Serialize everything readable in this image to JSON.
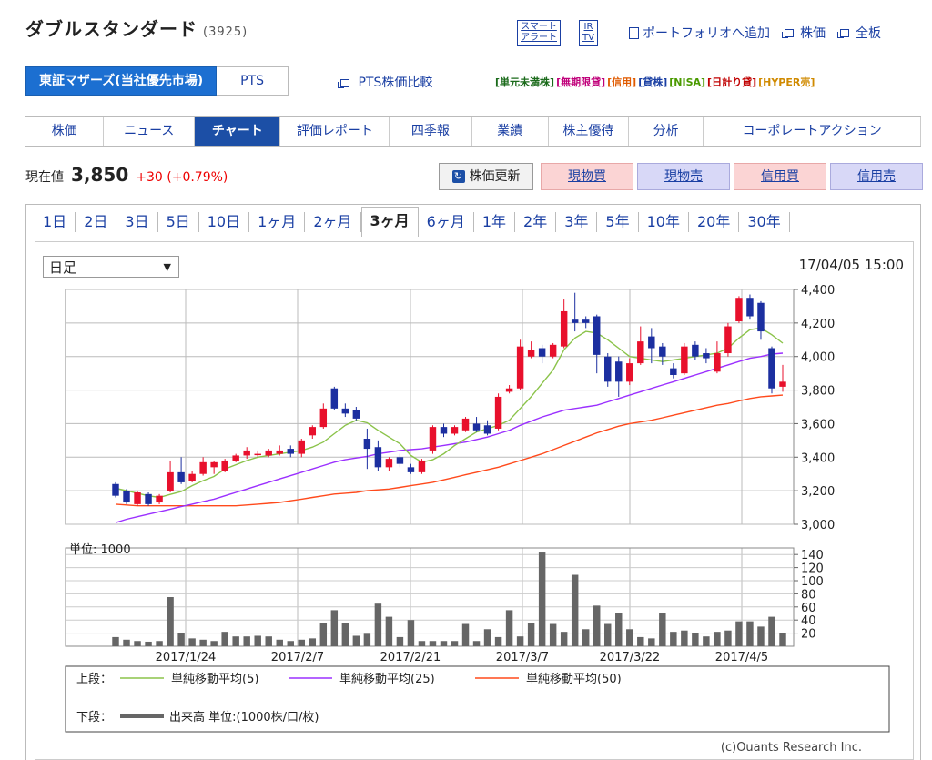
{
  "stock": {
    "name": "ダブルスタンダード",
    "code": "(3925)"
  },
  "top_links": {
    "smart_alert": [
      "スマート",
      "アラート"
    ],
    "ir_tv": [
      "IR",
      "TV"
    ],
    "portfolio": "ポートフォリオへ追加",
    "kabuka": "株価",
    "zenban": "全板"
  },
  "market_tabs": {
    "active": "東証マザーズ(当社優先市場)",
    "other": "PTS"
  },
  "pts_compare": "PTS株価比較",
  "badges": [
    {
      "text": "[単元未満株]",
      "color": "#1a6a1a"
    },
    {
      "text": "[無期限貸]",
      "color": "#c0007a"
    },
    {
      "text": "[信用]",
      "color": "#e05a00"
    },
    {
      "text": "[貸株]",
      "color": "#1a3fa3"
    },
    {
      "text": "[NISA]",
      "color": "#4a9a00"
    },
    {
      "text": "[日計り貸]",
      "color": "#c00000"
    },
    {
      "text": "[HYPER売]",
      "color": "#d08a00"
    }
  ],
  "nav": [
    "株価",
    "ニュース",
    "チャート",
    "評価レポート",
    "四季報",
    "業績",
    "株主優待",
    "分析",
    "コーポレートアクション"
  ],
  "nav_active": "チャート",
  "quote": {
    "label": "現在値",
    "price": "3,850",
    "change": "+30 (+0.79%)"
  },
  "actions": {
    "refresh": "株価更新",
    "cash_buy": "現物買",
    "cash_sell": "現物売",
    "margin_buy": "信用買",
    "margin_sell": "信用売"
  },
  "periods": [
    "1日",
    "2日",
    "3日",
    "5日",
    "10日",
    "1ヶ月",
    "2ヶ月",
    "3ヶ月",
    "6ヶ月",
    "1年",
    "2年",
    "3年",
    "5年",
    "10年",
    "20年",
    "30年"
  ],
  "period_active": "3ヶ月",
  "chart_type_select": "日足",
  "timestamp": "17/04/05 15:00",
  "chart_data": {
    "type": "candlestick",
    "x_labels": [
      "2017/1/24",
      "2017/2/7",
      "2017/2/21",
      "2017/3/7",
      "2017/3/22",
      "2017/4/5"
    ],
    "price_axis": {
      "ticks": [
        "4,400",
        "4,200",
        "4,000",
        "3,800",
        "3,600",
        "3,400",
        "3,200",
        "3,000"
      ],
      "ylim": [
        3000,
        4400
      ]
    },
    "volume_axis": {
      "unit_label": "単位: 1000",
      "ticks": [
        "140",
        "120",
        "100",
        "80",
        "60",
        "40",
        "20"
      ],
      "ylim": [
        0,
        150
      ]
    },
    "candles": [
      {
        "o": 3240,
        "c": 3170,
        "h": 3250,
        "l": 3160
      },
      {
        "o": 3200,
        "c": 3130,
        "h": 3210,
        "l": 3120
      },
      {
        "o": 3120,
        "c": 3190,
        "h": 3200,
        "l": 3110
      },
      {
        "o": 3180,
        "c": 3120,
        "h": 3190,
        "l": 3110
      },
      {
        "o": 3130,
        "c": 3170,
        "h": 3180,
        "l": 3120
      },
      {
        "o": 3200,
        "c": 3310,
        "h": 3380,
        "l": 3190
      },
      {
        "o": 3310,
        "c": 3250,
        "h": 3400,
        "l": 3240
      },
      {
        "o": 3260,
        "c": 3300,
        "h": 3320,
        "l": 3250
      },
      {
        "o": 3300,
        "c": 3370,
        "h": 3400,
        "l": 3290
      },
      {
        "o": 3340,
        "c": 3370,
        "h": 3380,
        "l": 3300
      },
      {
        "o": 3320,
        "c": 3380,
        "h": 3390,
        "l": 3310
      },
      {
        "o": 3380,
        "c": 3410,
        "h": 3420,
        "l": 3370
      },
      {
        "o": 3410,
        "c": 3440,
        "h": 3460,
        "l": 3390
      },
      {
        "o": 3420,
        "c": 3420,
        "h": 3440,
        "l": 3400
      },
      {
        "o": 3410,
        "c": 3440,
        "h": 3450,
        "l": 3400
      },
      {
        "o": 3420,
        "c": 3440,
        "h": 3470,
        "l": 3410
      },
      {
        "o": 3450,
        "c": 3420,
        "h": 3470,
        "l": 3400
      },
      {
        "o": 3420,
        "c": 3500,
        "h": 3510,
        "l": 3400
      },
      {
        "o": 3530,
        "c": 3580,
        "h": 3590,
        "l": 3510
      },
      {
        "o": 3580,
        "c": 3690,
        "h": 3720,
        "l": 3570
      },
      {
        "o": 3810,
        "c": 3690,
        "h": 3820,
        "l": 3680
      },
      {
        "o": 3690,
        "c": 3660,
        "h": 3720,
        "l": 3640
      },
      {
        "o": 3680,
        "c": 3630,
        "h": 3700,
        "l": 3620
      },
      {
        "o": 3510,
        "c": 3450,
        "h": 3570,
        "l": 3330
      },
      {
        "o": 3460,
        "c": 3340,
        "h": 3500,
        "l": 3320
      },
      {
        "o": 3340,
        "c": 3390,
        "h": 3400,
        "l": 3320
      },
      {
        "o": 3400,
        "c": 3360,
        "h": 3420,
        "l": 3340
      },
      {
        "o": 3340,
        "c": 3310,
        "h": 3360,
        "l": 3300
      },
      {
        "o": 3310,
        "c": 3380,
        "h": 3390,
        "l": 3300
      },
      {
        "o": 3440,
        "c": 3580,
        "h": 3590,
        "l": 3420
      },
      {
        "o": 3580,
        "c": 3540,
        "h": 3600,
        "l": 3520
      },
      {
        "o": 3540,
        "c": 3580,
        "h": 3590,
        "l": 3530
      },
      {
        "o": 3560,
        "c": 3630,
        "h": 3640,
        "l": 3550
      },
      {
        "o": 3600,
        "c": 3560,
        "h": 3640,
        "l": 3550
      },
      {
        "o": 3590,
        "c": 3540,
        "h": 3620,
        "l": 3530
      },
      {
        "o": 3570,
        "c": 3760,
        "h": 3780,
        "l": 3560
      },
      {
        "o": 3790,
        "c": 3810,
        "h": 3830,
        "l": 3780
      },
      {
        "o": 3810,
        "c": 4060,
        "h": 4100,
        "l": 3800
      },
      {
        "o": 4000,
        "c": 4040,
        "h": 4090,
        "l": 3990
      },
      {
        "o": 4050,
        "c": 4000,
        "h": 4070,
        "l": 3960
      },
      {
        "o": 4000,
        "c": 4070,
        "h": 4080,
        "l": 3990
      },
      {
        "o": 4060,
        "c": 4270,
        "h": 4340,
        "l": 4050
      },
      {
        "o": 4220,
        "c": 4200,
        "h": 4380,
        "l": 4150
      },
      {
        "o": 4220,
        "c": 4200,
        "h": 4240,
        "l": 4170
      },
      {
        "o": 4240,
        "c": 4010,
        "h": 4250,
        "l": 3900
      },
      {
        "o": 4000,
        "c": 3850,
        "h": 4020,
        "l": 3820
      },
      {
        "o": 3970,
        "c": 3850,
        "h": 4000,
        "l": 3760
      },
      {
        "o": 3850,
        "c": 3960,
        "h": 3990,
        "l": 3830
      },
      {
        "o": 3960,
        "c": 4090,
        "h": 4180,
        "l": 3950
      },
      {
        "o": 4120,
        "c": 4050,
        "h": 4170,
        "l": 3960
      },
      {
        "o": 4060,
        "c": 4000,
        "h": 4080,
        "l": 3950
      },
      {
        "o": 3930,
        "c": 3890,
        "h": 3960,
        "l": 3870
      },
      {
        "o": 3900,
        "c": 4060,
        "h": 4080,
        "l": 3890
      },
      {
        "o": 4070,
        "c": 4000,
        "h": 4090,
        "l": 3980
      },
      {
        "o": 4020,
        "c": 3990,
        "h": 4050,
        "l": 3960
      },
      {
        "o": 3910,
        "c": 4020,
        "h": 4090,
        "l": 3900
      },
      {
        "o": 4020,
        "c": 4180,
        "h": 4200,
        "l": 4000
      },
      {
        "o": 4210,
        "c": 4350,
        "h": 4360,
        "l": 4200
      },
      {
        "o": 4350,
        "c": 4240,
        "h": 4370,
        "l": 4220
      },
      {
        "o": 4320,
        "c": 4150,
        "h": 4330,
        "l": 4100
      },
      {
        "o": 4050,
        "c": 3810,
        "h": 4060,
        "l": 3780
      },
      {
        "o": 3820,
        "c": 3850,
        "h": 3950,
        "l": 3790
      }
    ],
    "volumes": [
      14,
      10,
      8,
      7,
      8,
      75,
      20,
      12,
      10,
      8,
      22,
      15,
      15,
      16,
      15,
      10,
      8,
      10,
      12,
      36,
      55,
      36,
      16,
      19,
      65,
      45,
      14,
      40,
      8,
      8,
      8,
      8,
      34,
      8,
      26,
      14,
      55,
      15,
      36,
      143,
      34,
      22,
      109,
      26,
      62,
      34,
      50,
      26,
      14,
      12,
      50,
      22,
      24,
      20,
      15,
      22,
      24,
      38,
      38,
      30,
      45,
      20
    ],
    "sma5": [
      3215,
      3200,
      3185,
      3170,
      3160,
      3178,
      3195,
      3230,
      3260,
      3285,
      3330,
      3355,
      3380,
      3400,
      3410,
      3420,
      3430,
      3440,
      3460,
      3490,
      3540,
      3590,
      3620,
      3605,
      3560,
      3520,
      3480,
      3410,
      3370,
      3385,
      3420,
      3470,
      3510,
      3550,
      3570,
      3590,
      3620,
      3690,
      3760,
      3840,
      3920,
      4040,
      4110,
      4150,
      4140,
      4100,
      4050,
      4000,
      3990,
      3980,
      3970,
      3980,
      3990,
      4000,
      4010,
      4020,
      4050,
      4110,
      4160,
      4170,
      4130,
      4080
    ],
    "sma25": [
      3010,
      3030,
      3045,
      3060,
      3075,
      3090,
      3105,
      3120,
      3135,
      3150,
      3170,
      3190,
      3210,
      3230,
      3250,
      3270,
      3290,
      3310,
      3330,
      3350,
      3370,
      3385,
      3395,
      3405,
      3420,
      3430,
      3440,
      3445,
      3450,
      3460,
      3470,
      3480,
      3490,
      3505,
      3520,
      3540,
      3560,
      3590,
      3615,
      3640,
      3660,
      3680,
      3690,
      3700,
      3710,
      3730,
      3750,
      3770,
      3790,
      3810,
      3830,
      3850,
      3870,
      3890,
      3910,
      3930,
      3950,
      3970,
      3990,
      4000,
      4015,
      4020
    ],
    "sma50": [
      3120,
      3115,
      3110,
      3110,
      3110,
      3110,
      3110,
      3110,
      3110,
      3110,
      3110,
      3110,
      3115,
      3120,
      3125,
      3130,
      3140,
      3150,
      3160,
      3170,
      3180,
      3185,
      3190,
      3200,
      3205,
      3210,
      3220,
      3230,
      3240,
      3250,
      3265,
      3280,
      3295,
      3310,
      3325,
      3340,
      3360,
      3380,
      3400,
      3420,
      3445,
      3470,
      3495,
      3520,
      3545,
      3565,
      3585,
      3600,
      3610,
      3620,
      3635,
      3650,
      3665,
      3680,
      3695,
      3710,
      3720,
      3735,
      3750,
      3760,
      3765,
      3770
    ],
    "legend": {
      "top_label": "上段：",
      "bottom_label": "下段：",
      "sma5": "単純移動平均(5)",
      "sma25": "単純移動平均(25)",
      "sma50": "単純移動平均(50)",
      "volume": "出来高 単位:(1000株/口/枚)"
    },
    "colors": {
      "up": "#e8102c",
      "down": "#1c2fa0",
      "sma5": "#8bc34a",
      "sma25": "#9b30ff",
      "sma50": "#ff4a1c",
      "volume": "#666666"
    },
    "credit": "(c)Ouants Research Inc."
  }
}
